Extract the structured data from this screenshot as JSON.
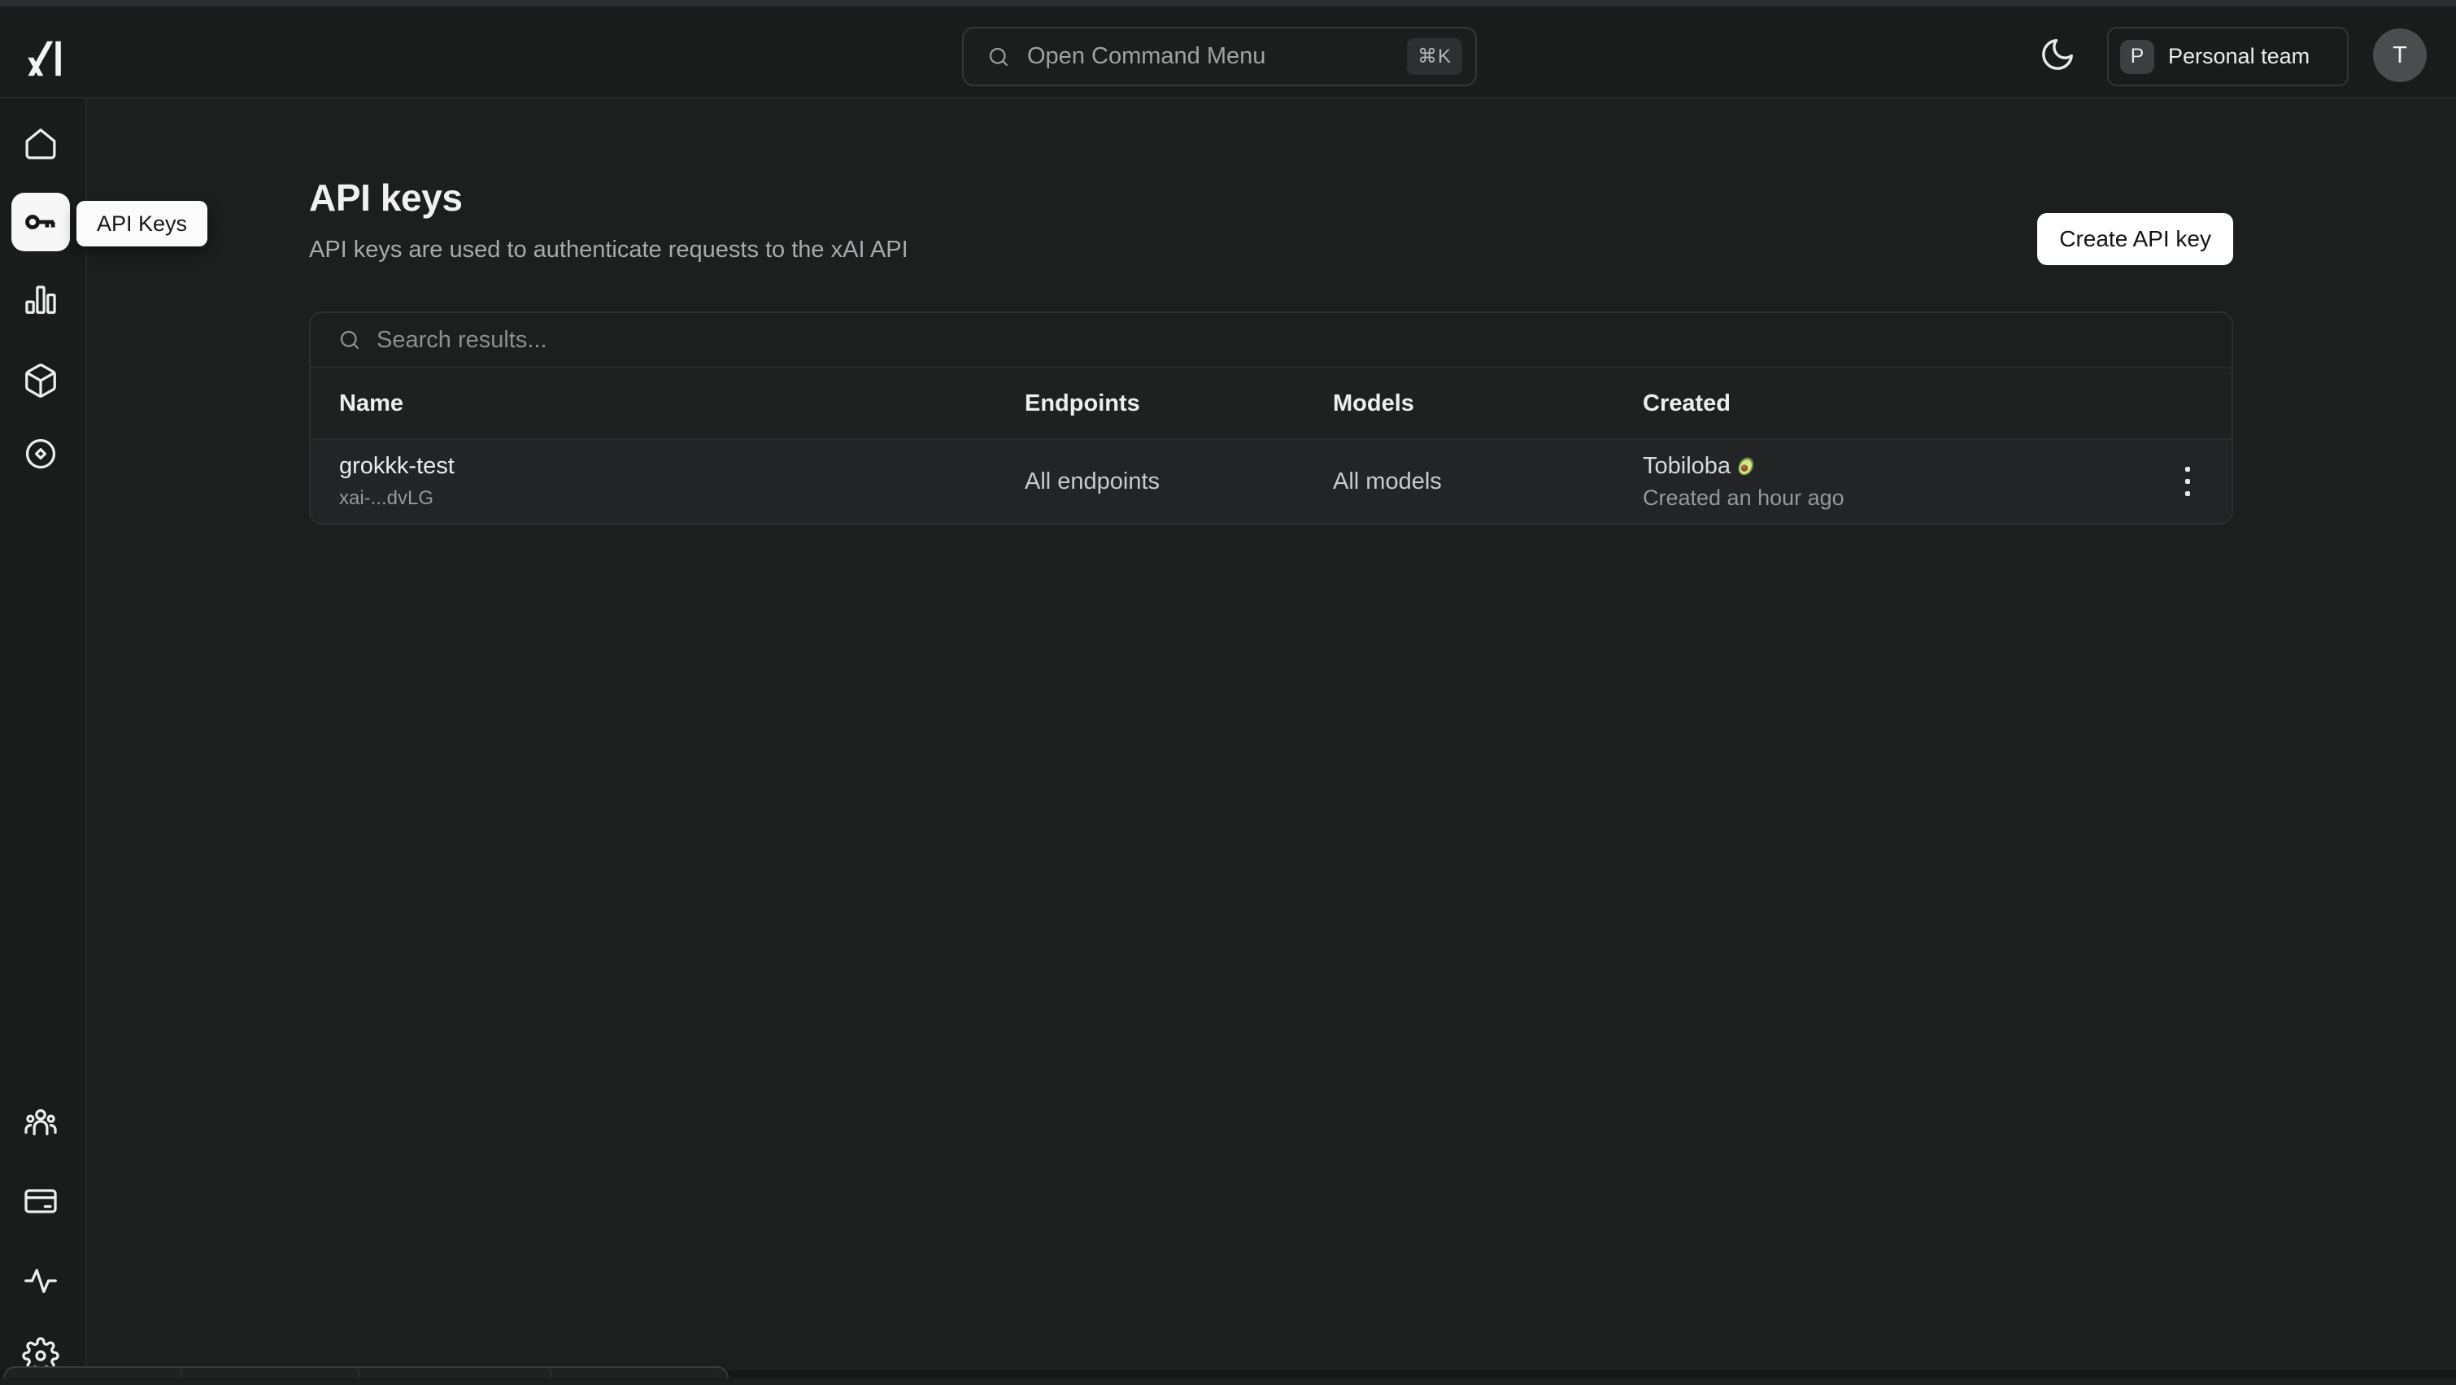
{
  "topbar": {
    "command_menu": {
      "placeholder": "Open Command Menu",
      "shortcut": "⌘K"
    },
    "theme_toggle_icon": "moon-icon",
    "team_switcher": {
      "initial": "P",
      "label": "Personal team"
    },
    "user_avatar": {
      "initial": "T"
    }
  },
  "sidebar": {
    "tooltip": "API Keys",
    "items": [
      {
        "id": "home",
        "icon": "home-icon",
        "active": false
      },
      {
        "id": "api-keys",
        "icon": "key-icon",
        "active": true
      },
      {
        "id": "usage",
        "icon": "bar-chart-icon",
        "active": false
      },
      {
        "id": "models",
        "icon": "box-icon",
        "active": false
      },
      {
        "id": "explore",
        "icon": "disc-icon",
        "active": false
      },
      {
        "id": "team",
        "icon": "users-icon",
        "active": false
      },
      {
        "id": "billing",
        "icon": "credit-card-icon",
        "active": false
      },
      {
        "id": "activity",
        "icon": "activity-icon",
        "active": false
      },
      {
        "id": "settings",
        "icon": "gear-icon",
        "active": false
      }
    ]
  },
  "page": {
    "title": "API keys",
    "subtitle": "API keys are used to authenticate requests to the xAI API",
    "create_button": "Create API key"
  },
  "table": {
    "search_placeholder": "Search results...",
    "columns": [
      "Name",
      "Endpoints",
      "Models",
      "Created"
    ],
    "rows": [
      {
        "name": "grokkk-test",
        "key_masked": "xai-...dvLG",
        "endpoints": "All endpoints",
        "models": "All models",
        "created_by": "Tobiloba",
        "created_by_emoji": "🥑",
        "created_at": "Created an hour ago",
        "menu_icon": "kebab-menu-icon"
      }
    ]
  },
  "colors": {
    "app_background": "#1d1e1e",
    "chrome_background": "#1a1b1b",
    "border": "#2d2f2f",
    "row_background": "#232425",
    "primary_button_background": "#ffffff",
    "primary_button_text": "#141414",
    "tooltip_background": "#fbfbfb",
    "text_primary": "#f1f1f1",
    "text_secondary": "#a8aaab"
  }
}
